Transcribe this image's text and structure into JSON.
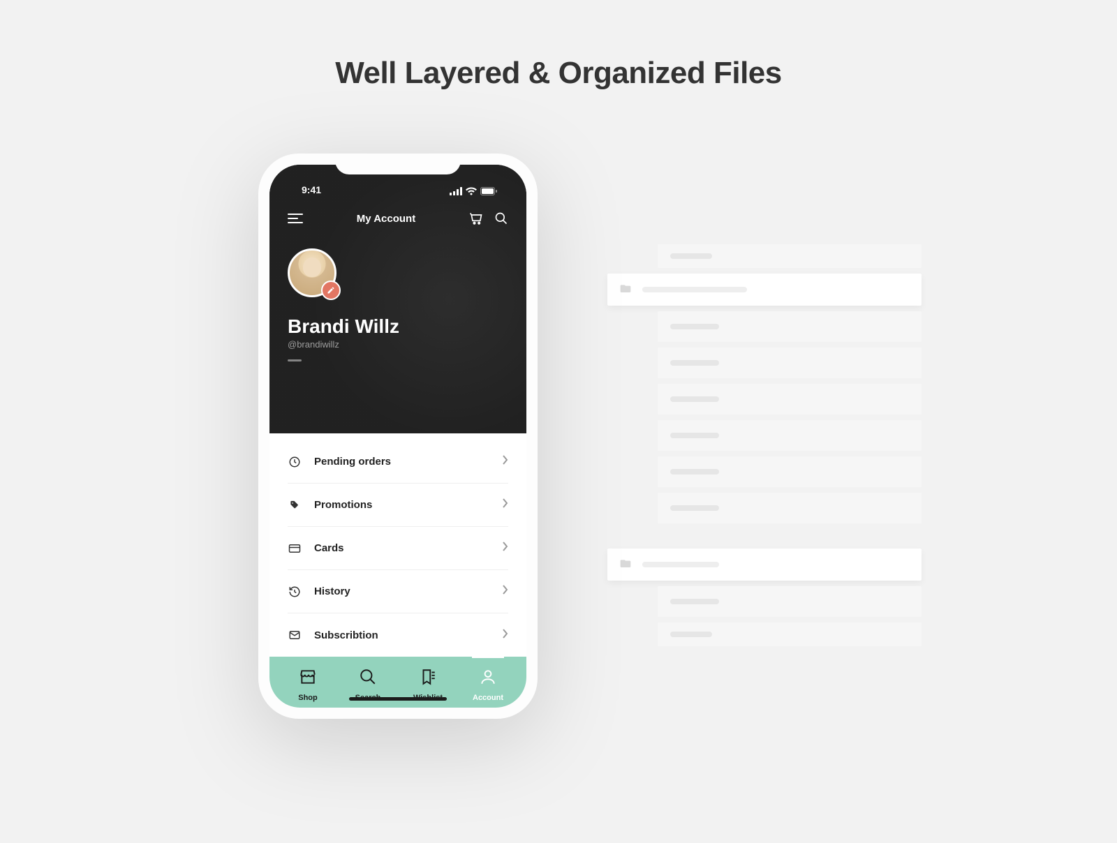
{
  "heading": "Well Layered & Organized Files",
  "status": {
    "time": "9:41"
  },
  "nav": {
    "title": "My Account"
  },
  "profile": {
    "name": "Brandi Willz",
    "handle": "@brandiwillz"
  },
  "menu": {
    "items": [
      {
        "icon": "clock-icon",
        "label": "Pending orders"
      },
      {
        "icon": "tag-icon",
        "label": "Promotions"
      },
      {
        "icon": "card-icon",
        "label": "Cards"
      },
      {
        "icon": "history-icon",
        "label": "History"
      },
      {
        "icon": "mail-icon",
        "label": "Subscribtion"
      }
    ]
  },
  "tabs": {
    "items": [
      {
        "label": "Shop",
        "active": false
      },
      {
        "label": "Search",
        "active": false
      },
      {
        "label": "Wishlist",
        "active": false
      },
      {
        "label": "Account",
        "active": true
      }
    ]
  }
}
